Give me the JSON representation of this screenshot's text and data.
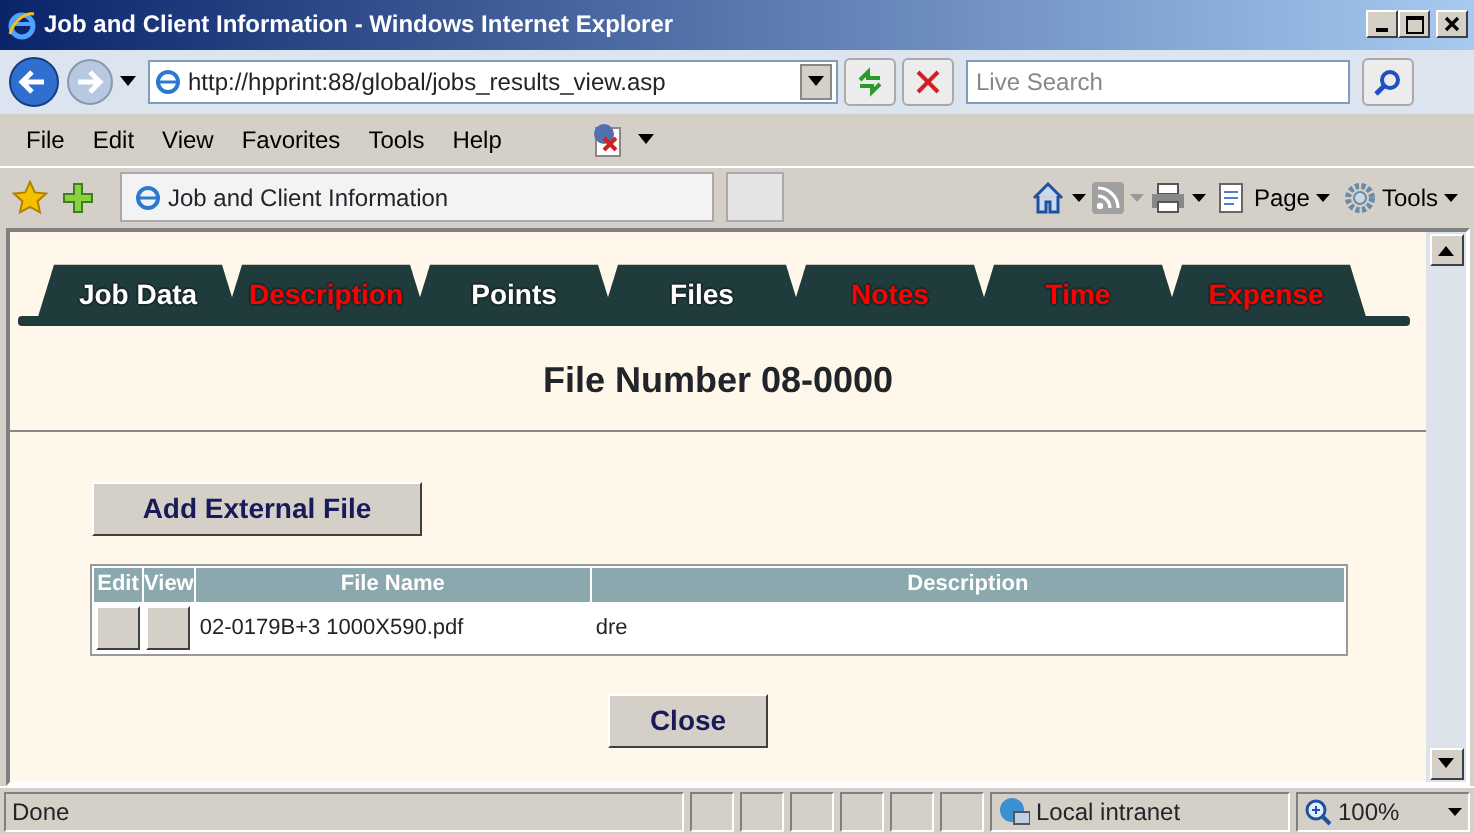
{
  "window": {
    "title": "Job and Client Information - Windows Internet Explorer"
  },
  "address_bar": {
    "url": "http://hpprint:88/global/jobs_results_view.asp"
  },
  "search": {
    "placeholder": "Live Search"
  },
  "menu": [
    "File",
    "Edit",
    "View",
    "Favorites",
    "Tools",
    "Help"
  ],
  "browser_tab": {
    "title": "Job and Client Information"
  },
  "command_bar": [
    "Page",
    "Tools"
  ],
  "tabs": [
    {
      "label": "Job Data",
      "color": "#ffffff"
    },
    {
      "label": "Description",
      "color": "#ff0000"
    },
    {
      "label": "Points",
      "color": "#ffffff"
    },
    {
      "label": "Files",
      "color": "#ffffff"
    },
    {
      "label": "Notes",
      "color": "#ff0000"
    },
    {
      "label": "Time",
      "color": "#ff0000"
    },
    {
      "label": "Expense",
      "color": "#ff0000"
    }
  ],
  "page": {
    "heading": "File Number 08-0000",
    "add_button": "Add External File",
    "table": {
      "columns": [
        "Edit",
        "View",
        "File Name",
        "Description"
      ],
      "rows": [
        {
          "file_name": "02-0179B+3 1000X590.pdf",
          "description": "dre"
        }
      ]
    },
    "close_button": "Close"
  },
  "status_bar": {
    "text": "Done",
    "zone": "Local intranet",
    "zoom": "100%"
  }
}
